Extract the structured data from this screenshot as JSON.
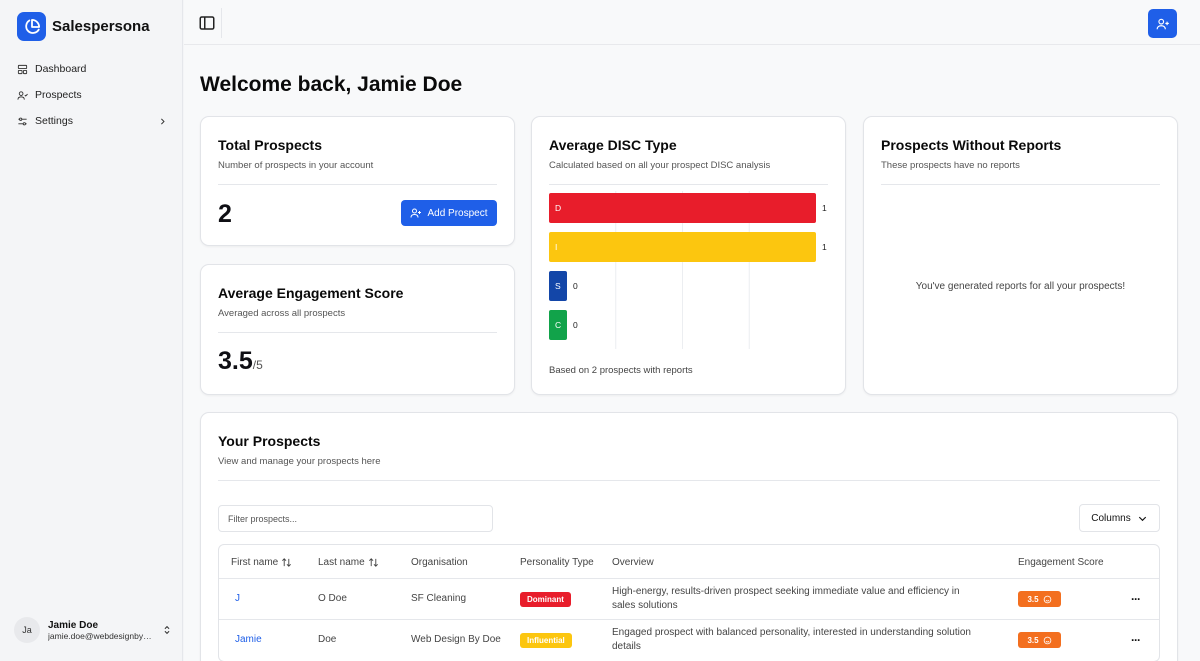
{
  "app": {
    "name": "Salespersona"
  },
  "sidebar": {
    "items": [
      {
        "label": "Dashboard"
      },
      {
        "label": "Prospects"
      },
      {
        "label": "Settings"
      }
    ],
    "user": {
      "initials": "Ja",
      "name": "Jamie Doe",
      "email": "jamie.doe@webdesignbydoe.com"
    }
  },
  "header": {
    "welcome": "Welcome back, Jamie Doe"
  },
  "cards": {
    "total_prospects": {
      "title": "Total Prospects",
      "subtitle": "Number of prospects in your account",
      "value": "2",
      "button_label": "Add Prospect"
    },
    "engagement": {
      "title": "Average Engagement Score",
      "subtitle": "Averaged across all prospects",
      "value": "3.5",
      "denominator": "/5"
    },
    "disc": {
      "title": "Average DISC Type",
      "subtitle": "Calculated based on all your prospect DISC analysis",
      "footer": "Based on 2 prospects with reports"
    },
    "no_reports": {
      "title": "Prospects Without Reports",
      "subtitle": "These prospects have no reports",
      "empty_message": "You've generated reports for all your prospects!"
    }
  },
  "chart_data": {
    "type": "bar",
    "orientation": "horizontal",
    "categories": [
      "D",
      "I",
      "S",
      "C"
    ],
    "values": [
      1,
      1,
      0,
      0
    ],
    "colors": [
      "#e81d2b",
      "#fcc60f",
      "#1346a8",
      "#11a34a"
    ],
    "title": "Average DISC Type",
    "xlim": [
      0,
      1
    ],
    "grid": true
  },
  "prospects_section": {
    "title": "Your Prospects",
    "subtitle": "View and manage your prospects here",
    "filter_placeholder": "Filter prospects...",
    "columns_label": "Columns",
    "headers": [
      "First name",
      "Last name",
      "Organisation",
      "Personality Type",
      "Overview",
      "Engagement Score"
    ],
    "rows": [
      {
        "first_name": "J",
        "last_name": "O Doe",
        "organisation": "SF Cleaning",
        "personality": "Dominant",
        "personality_color": "#e81d2b",
        "overview": "High-energy, results-driven prospect seeking immediate value and efficiency in sales solutions",
        "score": "3.5"
      },
      {
        "first_name": "Jamie",
        "last_name": "Doe",
        "organisation": "Web Design By Doe",
        "personality": "Influential",
        "personality_color": "#fcc60f",
        "overview": "Engaged prospect with balanced personality, interested in understanding solution details",
        "score": "3.5"
      }
    ]
  },
  "colors": {
    "accent": "#1f5fe8",
    "score": "#f36f1f"
  }
}
